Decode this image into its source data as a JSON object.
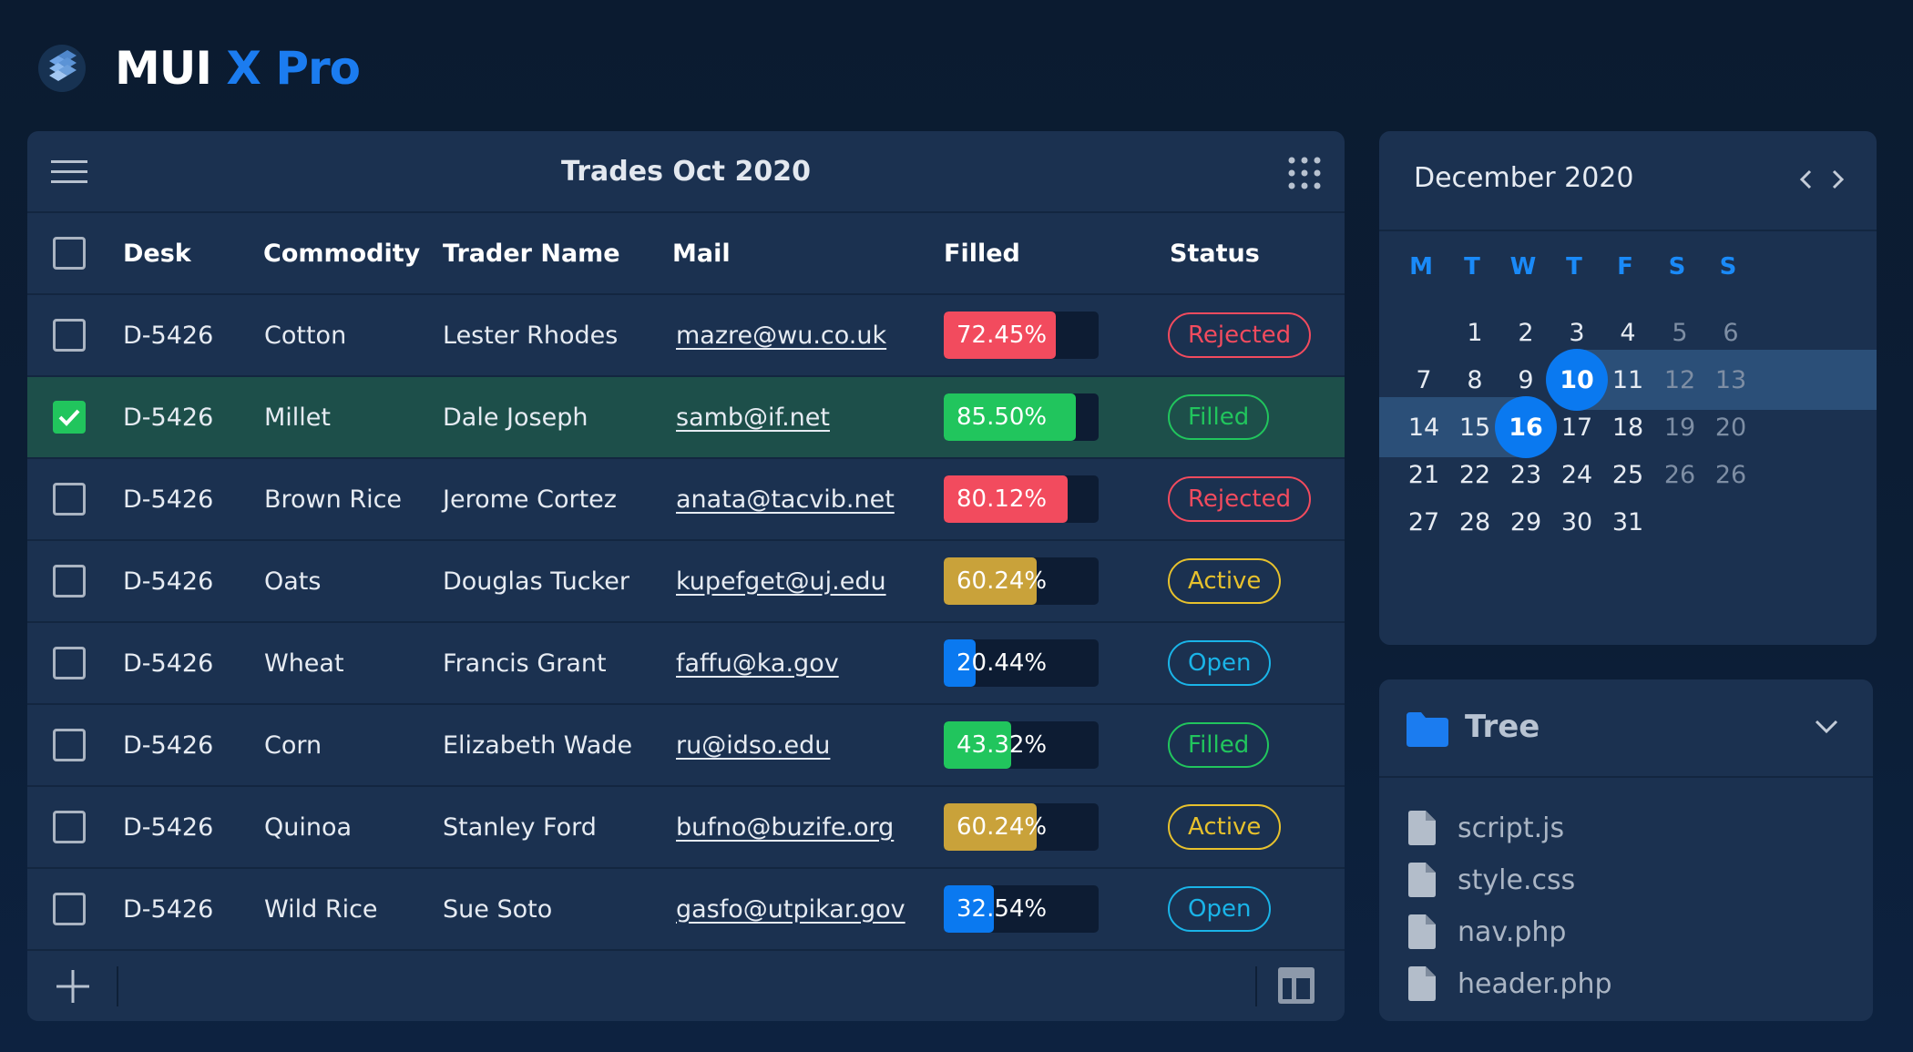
{
  "brand": {
    "word1": "MUI",
    "word2": "X Pro",
    "accent": "#1b7cf0"
  },
  "grid": {
    "title": "Trades Oct 2020",
    "columns": [
      "Desk",
      "Commodity",
      "Trader Name",
      "Mail",
      "Filled",
      "Status"
    ],
    "rows": [
      {
        "desk": "D-5426",
        "commodity": "Cotton",
        "trader": "Lester Rhodes",
        "mail": "mazre@wu.co.uk",
        "filled": "72.45%",
        "filled_value": 0.7245,
        "bar_color": "#f24b5e",
        "status": "Rejected",
        "status_color": "#f24b5e",
        "checked": false
      },
      {
        "desk": "D-5426",
        "commodity": "Millet",
        "trader": "Dale Joseph",
        "mail": "samb@if.net",
        "filled": "85.50%",
        "filled_value": 0.855,
        "bar_color": "#21c55d",
        "status": "Filled",
        "status_color": "#21c55d",
        "checked": true
      },
      {
        "desk": "D-5426",
        "commodity": "Brown Rice",
        "trader": "Jerome Cortez",
        "mail": "anata@tacvib.net",
        "filled": "80.12%",
        "filled_value": 0.8012,
        "bar_color": "#f24b5e",
        "status": "Rejected",
        "status_color": "#f24b5e",
        "checked": false
      },
      {
        "desk": "D-5426",
        "commodity": "Oats",
        "trader": "Douglas Tucker",
        "mail": "kupefget@uj.edu",
        "filled": "60.24%",
        "filled_value": 0.6024,
        "bar_color": "#c9a23a",
        "status": "Active",
        "status_color": "#e7c12d",
        "checked": false
      },
      {
        "desk": "D-5426",
        "commodity": "Wheat",
        "trader": "Francis Grant",
        "mail": "faffu@ka.gov",
        "filled": "20.44%",
        "filled_value": 0.2044,
        "bar_color": "#0a79f0",
        "status": "Open",
        "status_color": "#1ab4e8",
        "checked": false
      },
      {
        "desk": "D-5426",
        "commodity": "Corn",
        "trader": "Elizabeth Wade",
        "mail": "ru@idso.edu",
        "filled": "43.32%",
        "filled_value": 0.4332,
        "bar_color": "#21c55d",
        "status": "Filled",
        "status_color": "#21c55d",
        "checked": false
      },
      {
        "desk": "D-5426",
        "commodity": "Quinoa",
        "trader": "Stanley Ford",
        "mail": "bufno@buzife.org",
        "filled": "60.24%",
        "filled_value": 0.6024,
        "bar_color": "#c9a23a",
        "status": "Active",
        "status_color": "#e7c12d",
        "checked": false
      },
      {
        "desk": "D-5426",
        "commodity": "Wild Rice",
        "trader": "Sue Soto",
        "mail": "gasfo@utpikar.gov",
        "filled": "32.54%",
        "filled_value": 0.3254,
        "bar_color": "#0a79f0",
        "status": "Open",
        "status_color": "#1ab4e8",
        "checked": false
      }
    ]
  },
  "calendar": {
    "title": "December 2020",
    "weekdays": [
      "M",
      "T",
      "W",
      "T",
      "F",
      "S",
      "S"
    ],
    "weeks": [
      [
        "",
        "1",
        "2",
        "3",
        "4",
        "5",
        "6"
      ],
      [
        "7",
        "8",
        "9",
        "10",
        "11",
        "12",
        "13"
      ],
      [
        "14",
        "15",
        "16",
        "17",
        "18",
        "19",
        "20"
      ],
      [
        "21",
        "22",
        "23",
        "24",
        "25",
        "26",
        "26"
      ],
      [
        "27",
        "28",
        "29",
        "30",
        "31",
        "",
        ""
      ]
    ],
    "selected": [
      "10",
      "16"
    ]
  },
  "tree": {
    "title": "Tree",
    "items": [
      "script.js",
      "style.css",
      "nav.php",
      "header.php"
    ]
  }
}
